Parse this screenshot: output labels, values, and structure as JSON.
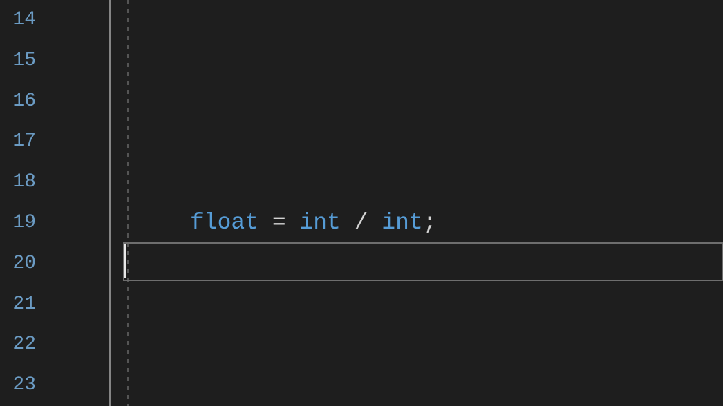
{
  "editor": {
    "line_numbers": [
      "14",
      "15",
      "16",
      "17",
      "18",
      "19",
      "20",
      "21",
      "22",
      "23"
    ],
    "active_line_index": 6,
    "code": {
      "line_18": {
        "token_float": "float",
        "token_equals": " = ",
        "token_int1": "int",
        "token_slash": " / ",
        "token_int2": "int",
        "token_semicolon": ";"
      }
    }
  }
}
